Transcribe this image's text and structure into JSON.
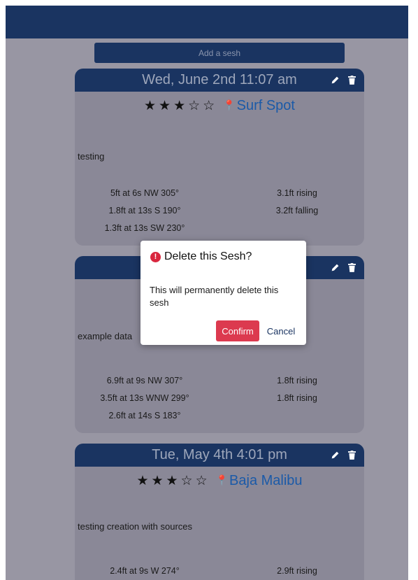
{
  "header": {
    "add_button_label": "Add a sesh"
  },
  "sessions": [
    {
      "date": "Wed, June 2nd 11:07 am",
      "stars": "★★★☆☆",
      "rating": 3,
      "spot": "Surf Spot",
      "notes": "testing",
      "swells": [
        "5ft at 6s NW 305°",
        "1.8ft at 13s S 190°",
        "1.3ft at 13s SW 230°"
      ],
      "tides": [
        "3.1ft rising",
        "3.2ft falling"
      ]
    },
    {
      "date": "",
      "stars": "",
      "spot": "",
      "notes": "example data",
      "swells": [
        "6.9ft at 9s NW 307°",
        "3.5ft at 13s WNW 299°",
        "2.6ft at 14s S 183°"
      ],
      "tides": [
        "1.8ft rising",
        "1.8ft rising"
      ]
    },
    {
      "date": "Tue, May 4th 4:01 pm",
      "stars": "★★★☆☆",
      "rating": 3,
      "spot": "Baja Malibu",
      "notes": "testing creation with sources",
      "swells": [
        "2.4ft at 9s W 274°"
      ],
      "tides": [
        "2.9ft rising"
      ]
    }
  ],
  "modal": {
    "title": "Delete this Sesh?",
    "alert_glyph": "!",
    "body": "This will permanently delete this sesh",
    "confirm_label": "Confirm",
    "cancel_label": "Cancel"
  },
  "icons": {
    "edit": "pencil-icon",
    "delete": "trash-icon",
    "location": "map-pin-icon",
    "alert": "alert-circle-icon"
  },
  "colors": {
    "navy": "#1a3461",
    "link": "#1b5aa8",
    "danger": "#dc3a4f"
  }
}
